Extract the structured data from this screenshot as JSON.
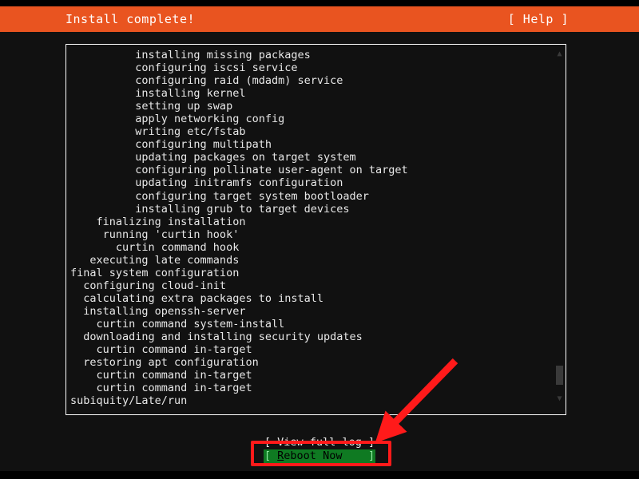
{
  "header": {
    "title": "Install complete!",
    "help_label": "[ Help ]",
    "background_color": "#e95420",
    "text_color": "#ffffff"
  },
  "log_panel": {
    "lines": [
      "          installing missing packages",
      "          configuring iscsi service",
      "          configuring raid (mdadm) service",
      "          installing kernel",
      "          setting up swap",
      "          apply networking config",
      "          writing etc/fstab",
      "          configuring multipath",
      "          updating packages on target system",
      "          configuring pollinate user-agent on target",
      "          updating initramfs configuration",
      "          configuring target system bootloader",
      "          installing grub to target devices",
      "    finalizing installation",
      "     running 'curtin hook'",
      "       curtin command hook",
      "   executing late commands",
      "final system configuration",
      "  configuring cloud-init",
      "  calculating extra packages to install",
      "  installing openssh-server",
      "    curtin command system-install",
      "  downloading and installing security updates",
      "    curtin command in-target",
      "  restoring apt configuration",
      "    curtin command in-target",
      "    curtin command in-target",
      "subiquity/Late/run"
    ],
    "scrollbar": {
      "up_arrow": "▲",
      "down_arrow": "▼"
    }
  },
  "actions": {
    "view_full_log": "[ View full log ]",
    "reboot_open_bracket": "[ ",
    "reboot_accesskey": "R",
    "reboot_label_rest": "eboot Now",
    "reboot_trailing_space": "    ",
    "reboot_close_bracket": "]",
    "reboot_full_label": "[ Reboot Now    ]",
    "reboot_highlight_color": "#0f7a22",
    "reboot_text_color": "#000000"
  },
  "annotation": {
    "box_color": "#ff1a1a",
    "arrow_color": "#ff1a1a"
  }
}
